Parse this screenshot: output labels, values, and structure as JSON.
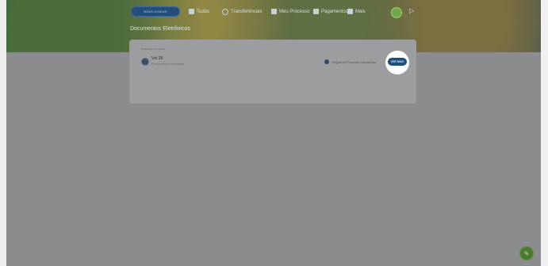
{
  "header": {
    "pill_label": "BOAS-VINDAS",
    "nav": [
      {
        "icon": "grid-icon",
        "label": "Todos"
      },
      {
        "icon": "exchange-icon",
        "label": "Transferências"
      },
      {
        "icon": "document-icon",
        "label": "Meu Processo"
      },
      {
        "icon": "card-icon",
        "label": "Pagamentos"
      },
      {
        "icon": "apps-icon",
        "label": "Mais"
      }
    ]
  },
  "page": {
    "title": "Documentos Eletrônicos"
  },
  "card": {
    "header": "Assunto do caso",
    "doc_title": "Vol 26",
    "doc_subtitle": "Documentos recebidos",
    "status_label": "Registros Processo concluídos",
    "action_label": "VER MAIS"
  }
}
